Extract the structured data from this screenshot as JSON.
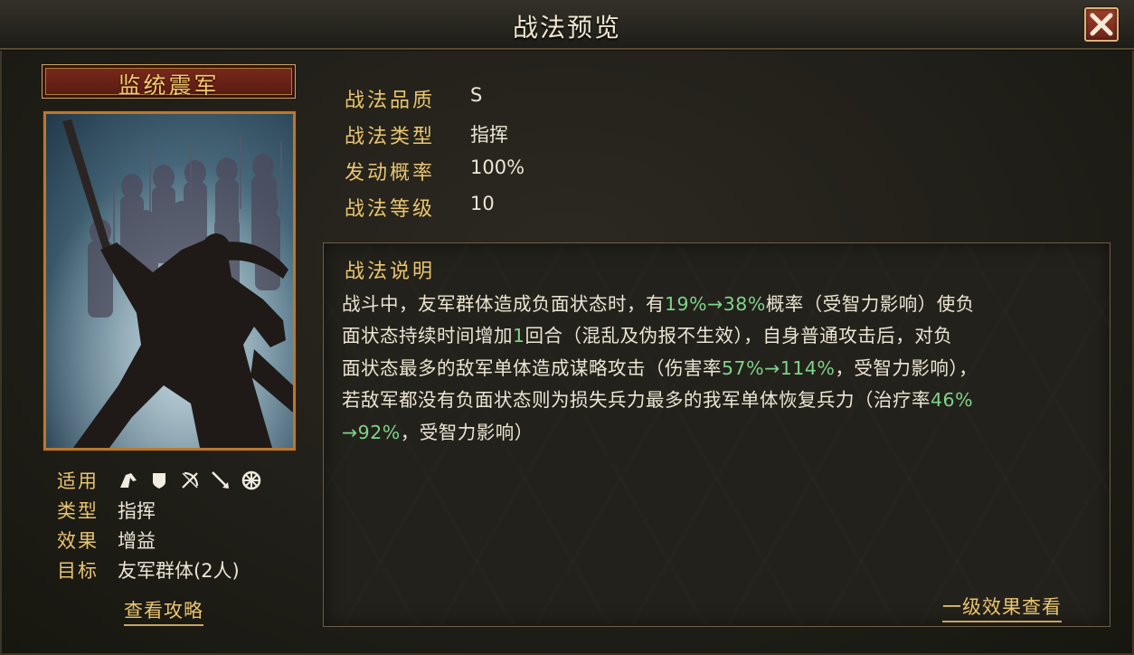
{
  "header": {
    "title": "战法预览"
  },
  "skill": {
    "name": "监统震军"
  },
  "meta": {
    "applicable_label": "适用",
    "applicable_icons": [
      "cavalry-icon",
      "shield-icon",
      "bow-icon",
      "spear-icon",
      "siege-icon"
    ],
    "type_label": "类型",
    "type_value": "指挥",
    "effect_label": "效果",
    "effect_value": "增益",
    "target_label": "目标",
    "target_value": "友军群体(2人)",
    "guide_link": "查看攻略"
  },
  "info": {
    "quality_label": "战法品质",
    "quality_value": "S",
    "type_label": "战法类型",
    "type_value": "指挥",
    "chance_label": "发动概率",
    "chance_value": "100%",
    "level_label": "战法等级",
    "level_value": "10"
  },
  "description": {
    "title": "战法说明",
    "l1a": "战斗中，友军群体造成负面状态时，有",
    "l1b": "19%→38%",
    "l1c": "概率（受智力影响）使负",
    "l2a": "面状态持续时间增加",
    "l2b": "1",
    "l2c": "回合（混乱及伪报不生效），自身普通攻击后，对负",
    "l3a": "面状态最多的敌军单体造成谋略攻击（伤害率",
    "l3b": "57%→114%",
    "l3c": "，受智力影响），",
    "l4a": "若敌军都没有负面状态则为损失兵力最多的我军单体恢复兵力（治疗率",
    "l4b": "46%",
    "l5a": "→92%",
    "l5b": "，受智力影响）"
  },
  "effect_link": "一级效果查看",
  "colors": {
    "gold": "#e9c570",
    "highlight_green": "#7fd38a",
    "banner_red": "#7a2a1c"
  }
}
